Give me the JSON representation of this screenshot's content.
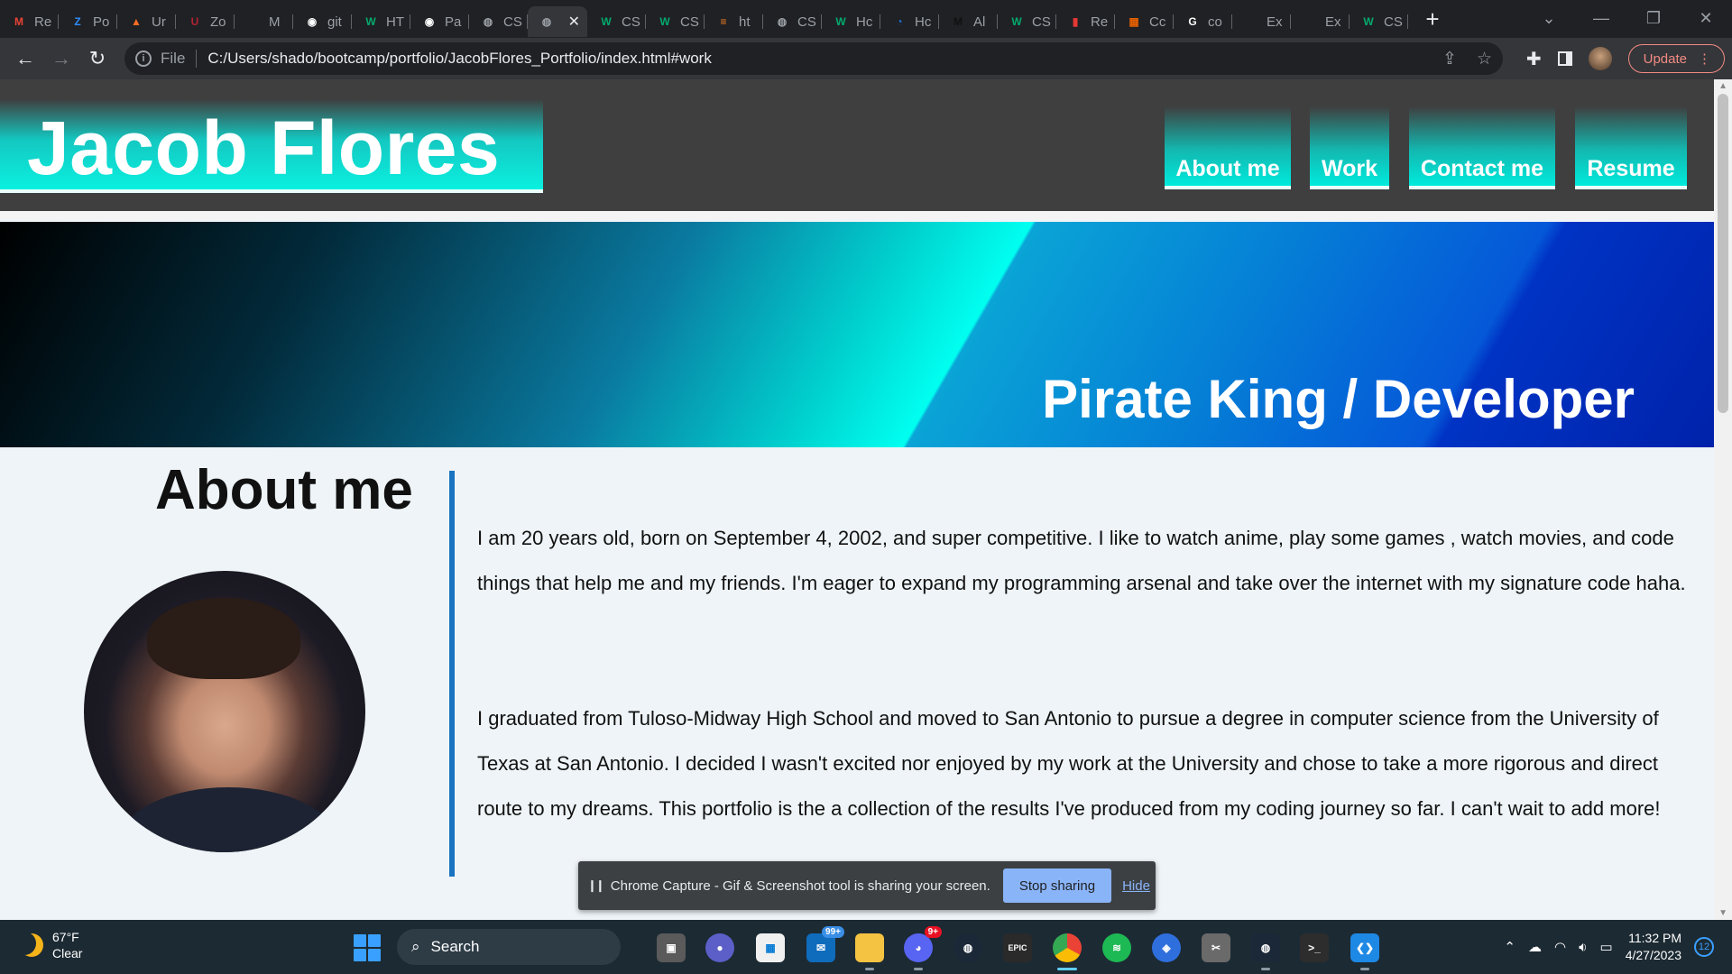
{
  "browser": {
    "tabs": [
      {
        "label": "Re",
        "icon": "gmail-icon",
        "color": "#ea4335",
        "glyph": "M"
      },
      {
        "label": "Po",
        "icon": "zoom-icon",
        "color": "#2d8cff",
        "glyph": "Z"
      },
      {
        "label": "Ur",
        "icon": "gitlab-icon",
        "color": "#fc6d26",
        "glyph": "▲"
      },
      {
        "label": "Zo",
        "icon": "usa-jobs-icon",
        "color": "#b22234",
        "glyph": "U"
      },
      {
        "label": "M",
        "icon": "medium-icon",
        "color": "#202124",
        "glyph": "·"
      },
      {
        "label": "git",
        "icon": "github-icon",
        "color": "#ffffff",
        "glyph": "◉"
      },
      {
        "label": "HT",
        "icon": "w3schools-icon",
        "color": "#04aa6d",
        "glyph": "W"
      },
      {
        "label": "Pa",
        "icon": "github-icon",
        "color": "#ffffff",
        "glyph": "◉"
      },
      {
        "label": "CS",
        "icon": "globe-icon",
        "color": "#9aa0a6",
        "glyph": "◍"
      },
      {
        "label": "",
        "icon": "globe-icon",
        "color": "#9aa0a6",
        "glyph": "◍",
        "active": true
      },
      {
        "label": "CS",
        "icon": "w3schools-icon",
        "color": "#04aa6d",
        "glyph": "W"
      },
      {
        "label": "CS",
        "icon": "w3schools-icon",
        "color": "#04aa6d",
        "glyph": "W"
      },
      {
        "label": "ht",
        "icon": "stackoverflow-icon",
        "color": "#f48024",
        "glyph": "≡"
      },
      {
        "label": "CS",
        "icon": "globe-icon",
        "color": "#9aa0a6",
        "glyph": "◍"
      },
      {
        "label": "Hc",
        "icon": "w3schools-icon",
        "color": "#04aa6d",
        "glyph": "W"
      },
      {
        "label": "Hc",
        "icon": "hackerrank-icon",
        "color": "#1a73e8",
        "glyph": "◔"
      },
      {
        "label": "Al",
        "icon": "m-icon",
        "color": "#111111",
        "glyph": "M"
      },
      {
        "label": "CS",
        "icon": "w3schools-icon",
        "color": "#04aa6d",
        "glyph": "W"
      },
      {
        "label": "Re",
        "icon": "utsa-icon",
        "color": "#e53935",
        "glyph": "▮"
      },
      {
        "label": "Cc",
        "icon": "canvas-icon",
        "color": "#e66000",
        "glyph": "▦"
      },
      {
        "label": "co",
        "icon": "google-icon",
        "color": "#ffffff",
        "glyph": "G"
      },
      {
        "label": "Ex",
        "icon": "puzzle-icon",
        "color": "#202124",
        "glyph": "✚"
      },
      {
        "label": "Ex",
        "icon": "puzzle-icon",
        "color": "#202124",
        "glyph": "✚"
      },
      {
        "label": "CS",
        "icon": "w3schools-icon",
        "color": "#04aa6d",
        "glyph": "W"
      }
    ],
    "url_scheme": "File",
    "url": "C:/Users/shado/bootcamp/portfolio/JacobFlores_Portfolio/index.html#work",
    "update_label": "Update"
  },
  "site": {
    "title": "Jacob Flores",
    "nav": [
      "About me",
      "Work",
      "Contact me",
      "Resume"
    ],
    "hero_title": "Pirate King / Developer",
    "about_heading": "About me",
    "para1": "I am 20 years old, born on September 4, 2002, and super competitive. I like to watch anime, play some games , watch movies, and code things that help me and my friends. I'm eager to expand my programming arsenal and take over the internet with my signature code haha.",
    "para2": "I graduated from Tuloso-Midway High School and moved to San Antonio to pursue a degree in computer science from the University of Texas at San Antonio. I decided I wasn't excited nor enjoyed by my work at the University and chose to take a more rigorous and direct route to my dreams. This portfolio is the a collection of the results I've produced from my coding journey so far. I can't wait to add more!"
  },
  "share_bar": {
    "message": "Chrome Capture - Gif & Screenshot tool is sharing your screen.",
    "stop_label": "Stop sharing",
    "hide_label": "Hide"
  },
  "taskbar": {
    "weather_temp": "67°F",
    "weather_desc": "Clear",
    "search_label": "Search",
    "mail_badge": "99+",
    "discord_badge": "9+",
    "epic_label": "EPIC",
    "time": "11:32 PM",
    "date": "4/27/2023",
    "notifications": "12"
  },
  "colors": {
    "accent_teal": "#00eadc",
    "header_gray": "#3f3f3f",
    "divider_blue": "#1a73c0",
    "stop_button": "#8ab4f8"
  }
}
